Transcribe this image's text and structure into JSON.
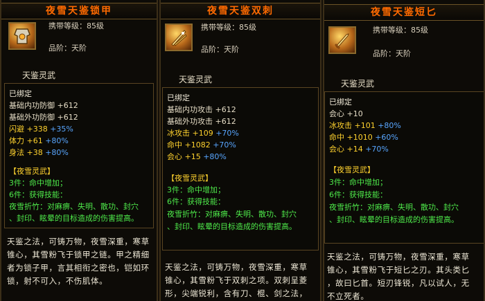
{
  "panels": [
    {
      "title": "夜雪天鉴锁甲",
      "icon": "armor-icon",
      "carry_level": "携带等级：85级",
      "grade": "品阶：天阶",
      "section": "天鉴灵武",
      "bound": "已绑定",
      "stats": [
        {
          "name": "基础内功防御",
          "value": "+612",
          "bonus": ""
        },
        {
          "name": "基础外功防御",
          "value": "+612",
          "bonus": ""
        },
        {
          "name": "闪避",
          "value": "+338",
          "bonus": "+35%"
        },
        {
          "name": "体力",
          "value": "+61",
          "bonus": "+80%"
        },
        {
          "name": "身法",
          "value": "+38",
          "bonus": "+80%"
        }
      ],
      "set_name": "【夜雪灵武】",
      "set_3": "3件：命中增加；",
      "set_6": "6件：获得技能：",
      "set_skill_1": "夜雪折竹：对麻痹、失明、散功、封穴",
      "set_skill_2": "、封印、眩晕的目标造成的伤害提高。",
      "lore": [
        "天鉴之法，可铸万物，夜雪深重，寒草",
        "锥心，其雪粉飞于锁甲之链。甲之精细",
        "者为锁子甲，言其相衔之密也，铠如环",
        "锁，射不可入，不伤肌体。"
      ]
    },
    {
      "title": "夜雪天鉴双刺",
      "icon": "twin-daggers-icon",
      "carry_level": "携带等级：85级",
      "grade": "品阶：天阶",
      "section": "天鉴灵武",
      "bound": "已绑定",
      "stats": [
        {
          "name": "基础内功攻击",
          "value": "+612",
          "bonus": ""
        },
        {
          "name": "基础外功攻击",
          "value": "+612",
          "bonus": ""
        },
        {
          "name": "冰攻击",
          "value": "+109",
          "bonus": "+70%"
        },
        {
          "name": "命中",
          "value": "+1082",
          "bonus": "+70%"
        },
        {
          "name": "会心",
          "value": "+15",
          "bonus": "+80%"
        }
      ],
      "set_name": "【夜雪灵武】",
      "set_3": "3件：命中增加；",
      "set_6": "6件：获得技能：",
      "set_skill_1": "夜雪折竹：对麻痹、失明、散功、封穴",
      "set_skill_2": "、封印、眩晕的目标造成的伤害提高。",
      "lore": [
        "天鉴之法，可铸万物，夜雪深重，寒草",
        "锥心，其雪粉飞于双刺之项。双刺呈菱",
        "形，尖端锐利，含有刀、棍、剑之法，"
      ]
    },
    {
      "title": "夜雪天鉴短匕",
      "icon": "dagger-icon",
      "carry_level": "携带等级：85级",
      "grade": "品阶：天阶",
      "section": "天鉴灵武",
      "bound": "已绑定",
      "stats": [
        {
          "name": "会心",
          "value": "+10",
          "bonus": ""
        },
        {
          "name": "冰攻击",
          "value": "+101",
          "bonus": "+80%"
        },
        {
          "name": "命中",
          "value": "+1010",
          "bonus": "+60%"
        },
        {
          "name": "会心",
          "value": "+14",
          "bonus": "+70%"
        }
      ],
      "set_name": "【夜雪灵武】",
      "set_3": "3件：命中增加；",
      "set_6": "6件：获得技能：",
      "set_skill_1": "夜雪折竹：对麻痹、失明、散功、封穴",
      "set_skill_2": "、封印、眩晕的目标造成的伤害提高。",
      "lore": [
        "天鉴之法，可铸万物，夜雪深重，寒草",
        "锥心，其雪粉飞于短匕之刃。其头类匕",
        "，故曰匕首。短刃锋锐，凡以试人，无",
        "不立死者。"
      ]
    }
  ]
}
